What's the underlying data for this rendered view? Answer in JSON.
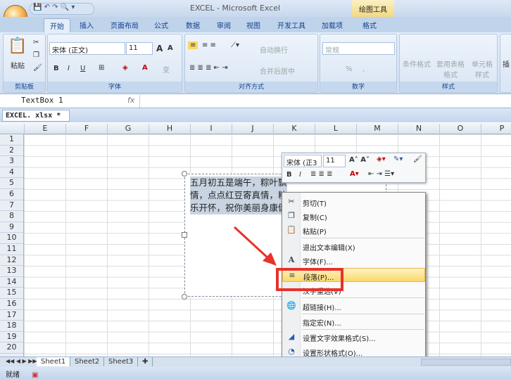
{
  "window": {
    "title": "EXCEL - Microsoft Excel",
    "context_tab_group": "绘图工具"
  },
  "tabs": [
    "开始",
    "插入",
    "页面布局",
    "公式",
    "数据",
    "审阅",
    "视图",
    "开发工具",
    "加载项",
    "格式"
  ],
  "ribbon": {
    "clipboard": {
      "paste": "粘贴",
      "label": "剪贴板"
    },
    "font": {
      "name": "宋体 (正文)",
      "size": "11",
      "label": "字体",
      "bold": "B",
      "italic": "I",
      "underline": "U",
      "grow": "A",
      "shrink": "A",
      "phonetic": "变"
    },
    "alignment": {
      "wrap": "自动换行",
      "merge": "合并后居中",
      "label": "对齐方式"
    },
    "number": {
      "format": "常规",
      "percent": "%",
      "comma": ",",
      "label": "数字"
    },
    "styles": {
      "conditional": "条件格式",
      "table": "套用表格格式",
      "cell": "单元格样式",
      "label": "样式"
    },
    "insert": "插"
  },
  "formula_bar": {
    "name_box": "TextBox 1",
    "fx": "fx",
    "value": ""
  },
  "workbook_tab": "EXCEL. xlsx  *",
  "columns": [
    "E",
    "F",
    "G",
    "H",
    "I",
    "J",
    "K",
    "L",
    "M",
    "N",
    "O",
    "P"
  ],
  "rows": [
    "1",
    "2",
    "3",
    "4",
    "5",
    "6",
    "7",
    "8",
    "9",
    "10",
    "11",
    "12",
    "13",
    "14",
    "15",
    "16",
    "17",
    "18",
    "19",
    "20"
  ],
  "textbox": {
    "lines": [
      "五月初五是端午，粽叶飘",
      "情，点点红豆寄真情，粒",
      "乐开怀，祝你美丽身康健"
    ]
  },
  "mini_toolbar": {
    "font": "宋体 (正3",
    "size": "11"
  },
  "context_menu": [
    {
      "label": "剪切(T)",
      "icon": "scissors-icon",
      "glyph": "✂"
    },
    {
      "label": "复制(C)",
      "icon": "copy-icon",
      "glyph": "❐"
    },
    {
      "label": "粘贴(P)",
      "icon": "paste-icon",
      "glyph": "📋"
    },
    {
      "label": "退出文本编辑(X)",
      "icon": "",
      "glyph": ""
    },
    {
      "label": "字体(F)...",
      "icon": "font-icon",
      "glyph": "A"
    },
    {
      "label": "段落(P)...",
      "icon": "paragraph-icon",
      "glyph": "≡"
    },
    {
      "label": "汉字重选(V)",
      "icon": "",
      "glyph": ""
    },
    {
      "label": "超链接(H)...",
      "icon": "hyperlink-icon",
      "glyph": "🌐"
    },
    {
      "label": "指定宏(N)...",
      "icon": "",
      "glyph": ""
    },
    {
      "label": "设置文字效果格式(S)...",
      "icon": "text-effect-icon",
      "glyph": "◢"
    },
    {
      "label": "设置形状格式(O)...",
      "icon": "shape-format-icon",
      "glyph": "◔"
    }
  ],
  "sheets": [
    "Sheet1",
    "Sheet2",
    "Sheet3"
  ],
  "status": "就绪",
  "colors": {
    "highlight": "#fbd767",
    "annotation": "#e8322a"
  }
}
